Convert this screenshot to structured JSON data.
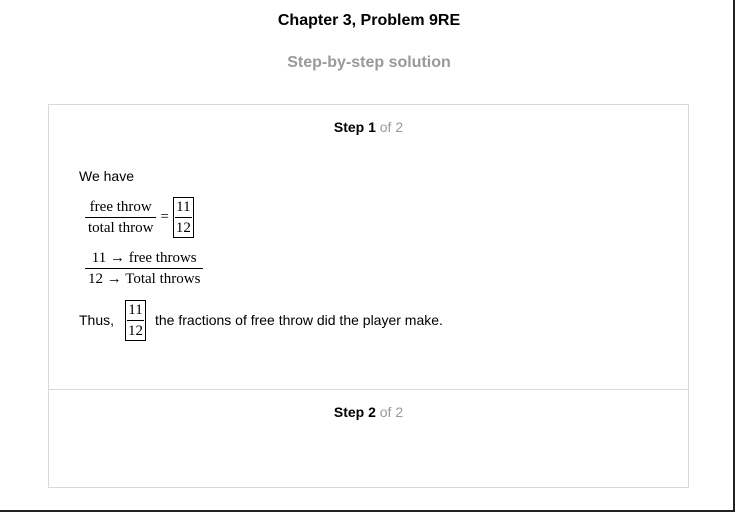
{
  "header": {
    "chapter_title": "Chapter 3, Problem 9RE",
    "subtitle": "Step-by-step solution"
  },
  "steps": [
    {
      "step_label": "Step 1",
      "of_label": "of 2",
      "intro": "We have",
      "eq1": {
        "numerator": "free throw",
        "denominator": "total throw",
        "equals": "=",
        "boxed_numerator": "11",
        "boxed_denominator": "12"
      },
      "eq2": {
        "numerator": "11 → free throws",
        "denominator": "12 → Total throws"
      },
      "conclusion": {
        "prefix": "Thus,",
        "boxed_numerator": "11",
        "boxed_denominator": "12",
        "suffix": "the fractions of free throw did the player make."
      }
    },
    {
      "step_label": "Step 2",
      "of_label": "of 2"
    }
  ]
}
